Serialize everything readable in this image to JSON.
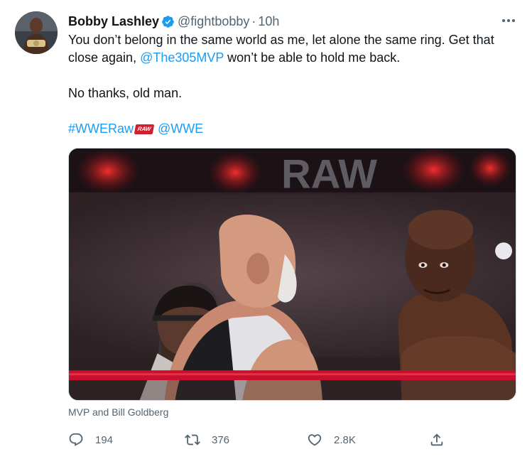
{
  "tweet": {
    "author": {
      "display_name": "Bobby Lashley",
      "handle": "@fightbobby",
      "verified": true
    },
    "separator": "·",
    "time": "10h",
    "text": {
      "line1_pre": "You don’t belong in the same world as me, let alone the same ring. Get that close again, ",
      "mention_mvp": "@The305MVP",
      "line1_post": " won’t be able to hold me back.",
      "para2": "No thanks, old man.",
      "hashtag": "#WWERaw",
      "hashflag_text": "RAW",
      "mention_wwe": "@WWE"
    },
    "media": {
      "caption": "MVP and Bill Goldberg",
      "backdrop_sign": "RAW"
    },
    "actions": {
      "replies": "194",
      "retweets": "376",
      "likes": "2.8K"
    },
    "colors": {
      "link": "#1d9bf0",
      "secondary_text": "#536471",
      "verified_badge": "#1d9bf0",
      "ring_rope": "#c8102e"
    },
    "icons": [
      "avatar-photo",
      "verified-badge-icon",
      "more-icon",
      "reply-icon",
      "retweet-icon",
      "like-icon",
      "share-icon"
    ]
  }
}
